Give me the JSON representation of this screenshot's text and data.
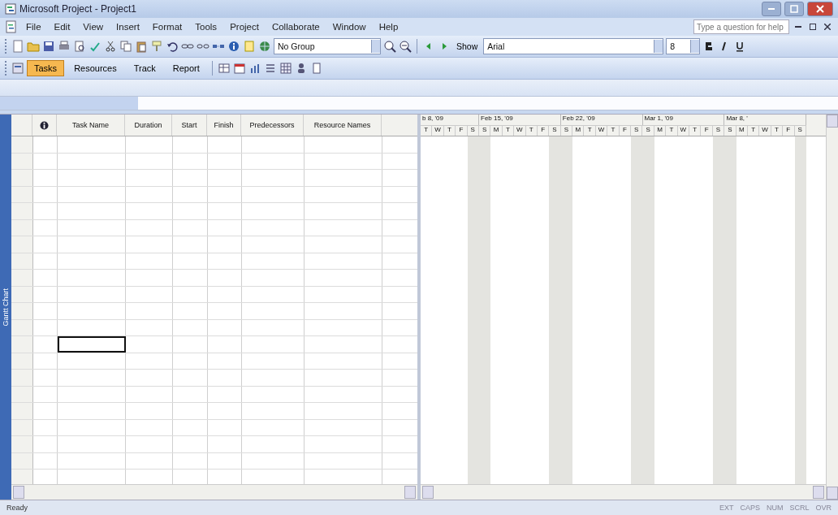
{
  "window": {
    "title": "Microsoft Project - Project1"
  },
  "menu": [
    "File",
    "Edit",
    "View",
    "Insert",
    "Format",
    "Tools",
    "Project",
    "Collaborate",
    "Window",
    "Help"
  ],
  "help_box": {
    "placeholder": "Type a question for help"
  },
  "standard_toolbar": {
    "group_field": {
      "value": "No Group"
    },
    "show_button": "Show",
    "font_field": {
      "value": "Arial"
    },
    "size_field": {
      "value": "8"
    }
  },
  "guide_toolbar": [
    {
      "label": "Tasks",
      "selected": true
    },
    {
      "label": "Resources",
      "selected": false
    },
    {
      "label": "Track",
      "selected": false
    },
    {
      "label": "Report",
      "selected": false
    }
  ],
  "view_bar": {
    "label": "Gantt Chart"
  },
  "table": {
    "columns": [
      {
        "kind": "icon"
      },
      {
        "kind": "text",
        "label": "Task Name"
      },
      {
        "kind": "text",
        "label": "Duration"
      },
      {
        "kind": "text",
        "label": "Start"
      },
      {
        "kind": "text",
        "label": "Finish"
      },
      {
        "kind": "text",
        "label": "Predecessors"
      },
      {
        "kind": "text",
        "label": "Resource Names"
      }
    ],
    "rows": [
      {
        "selected": false
      },
      {
        "selected": false
      },
      {
        "selected": false
      },
      {
        "selected": false
      },
      {
        "selected": false
      },
      {
        "selected": false
      },
      {
        "selected": false
      },
      {
        "selected": false
      },
      {
        "selected": false
      },
      {
        "selected": false
      },
      {
        "selected": false
      },
      {
        "selected": false
      },
      {
        "selected": true
      },
      {
        "selected": false
      },
      {
        "selected": false
      },
      {
        "selected": false
      },
      {
        "selected": false
      },
      {
        "selected": false
      },
      {
        "selected": false
      },
      {
        "selected": false
      },
      {
        "selected": false
      }
    ]
  },
  "timescale": {
    "weeks": [
      {
        "label": "b 8, '09",
        "days": [
          "T",
          "W",
          "T",
          "F",
          "S"
        ]
      },
      {
        "label": "Feb 15, '09",
        "days": [
          "S",
          "M",
          "T",
          "W",
          "T",
          "F",
          "S"
        ]
      },
      {
        "label": "Feb 22, '09",
        "days": [
          "S",
          "M",
          "T",
          "W",
          "T",
          "F",
          "S"
        ]
      },
      {
        "label": "Mar 1, '09",
        "days": [
          "S",
          "M",
          "T",
          "W",
          "T",
          "F",
          "S"
        ]
      },
      {
        "label": "Mar 8, '",
        "days": [
          "S",
          "M",
          "T",
          "W",
          "T",
          "F",
          "S"
        ]
      }
    ]
  },
  "status_bar": {
    "text": "Ready",
    "indicators": [
      "EXT",
      "CAPS",
      "NUM",
      "SCRL",
      "OVR"
    ]
  }
}
